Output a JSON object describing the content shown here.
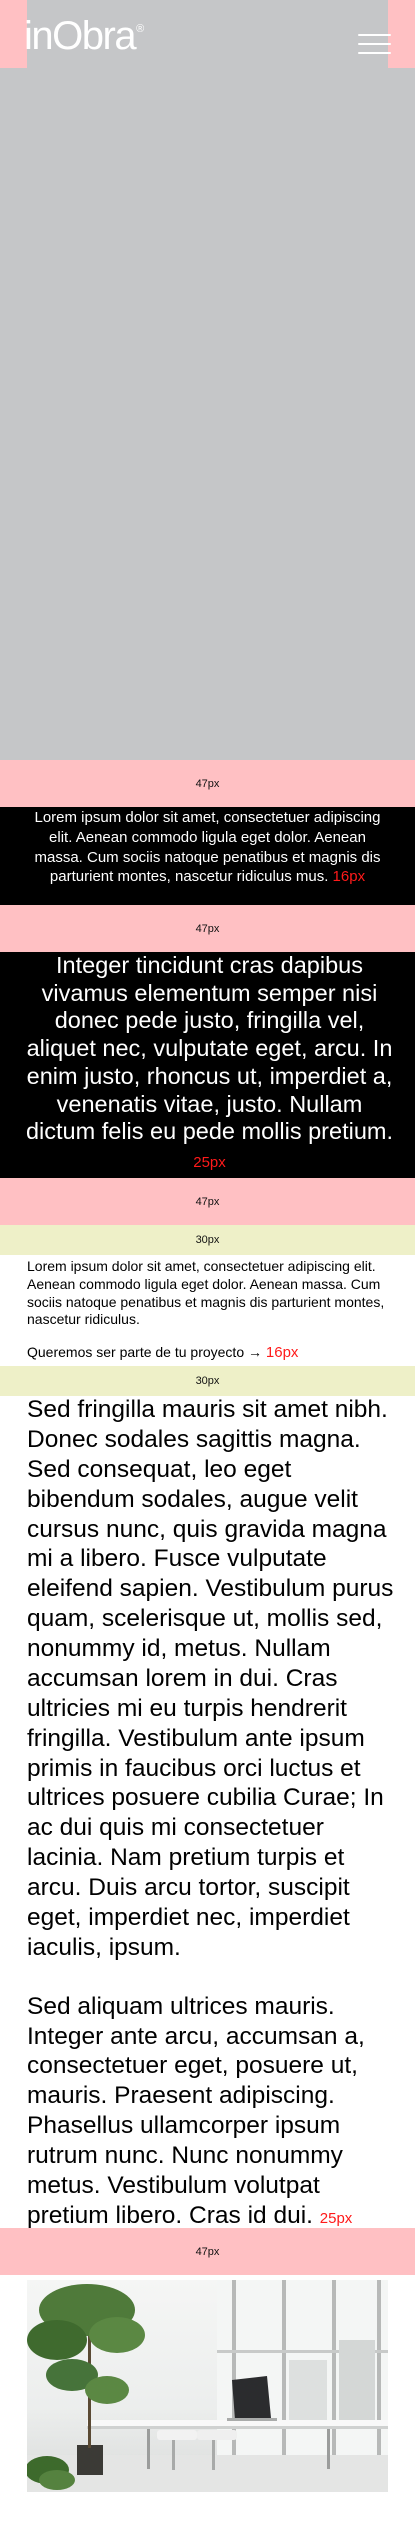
{
  "header": {
    "logo_text": "inObra",
    "logo_mark": "®",
    "menu_icon": "hamburger-menu-icon"
  },
  "spacers": {
    "s1": "47px",
    "s2": "47px",
    "s3": "47px",
    "s4": "30px",
    "s5": "30px",
    "s6": "47px"
  },
  "block16": {
    "text": "Lorem ipsum dolor sit amet, consectetuer adipiscing elit. Aenean commodo ligula eget dolor. Aenean massa. Cum sociis natoque penatibus et magnis dis parturient montes, nascetur ridiculus mus.",
    "size_label": "16px"
  },
  "block25": {
    "text": "Integer tincidunt cras dapibus vivamus elementum semper nisi donec pede justo, fringilla vel, aliquet nec, vulputate eget, arcu. In enim justo, rhoncus ut, imperdiet a, venenatis vitae, justo. Nullam dictum felis eu pede mollis pretium.",
    "size_label": "25px"
  },
  "intro": {
    "text": "Lorem ipsum dolor sit amet, consectetuer adipiscing elit. Aenean commodo ligula eget dolor. Aenean massa. Cum sociis natoque penatibus et magnis dis parturient montes, nascetur ridiculus.",
    "cta_label": "Queremos ser parte de tu proyecto →",
    "size_label": "16px"
  },
  "long_text": {
    "paragraph1": "Sed fringilla mauris sit amet nibh. Donec sodales sagittis magna. Sed consequat, leo eget bibendum sodales, augue velit cursus nunc, quis gravida magna mi a libero. Fusce vulputate eleifend sapien. Vestibulum purus quam, scelerisque ut, mollis sed, nonummy id, metus. Nullam accumsan lorem in dui. Cras ultricies mi eu turpis hendrerit fringilla. Vestibulum ante ipsum primis in faucibus orci luctus et ultrices posuere cubilia Curae; In ac dui quis mi consectetuer lacinia. Nam pretium turpis et arcu. Duis arcu tortor, suscipit eget, imperdiet nec, imperdiet iaculis, ipsum.",
    "paragraph2": "Sed aliquam ultrices mauris. Integer ante arcu, accumsan a, consectetuer eget, posuere ut, mauris. Praesent adipiscing. Phasellus ullamcorper ipsum rutrum nunc. Nunc nonummy metus. Vestibulum volutpat pretium libero. Cras id dui.",
    "size_label": "25px"
  },
  "colors": {
    "spacer_pink": "#ffc0c3",
    "spacer_cream": "#eef0c8",
    "size_label_red": "#ff1a1a",
    "hero_gray": "#c5c6c8"
  }
}
